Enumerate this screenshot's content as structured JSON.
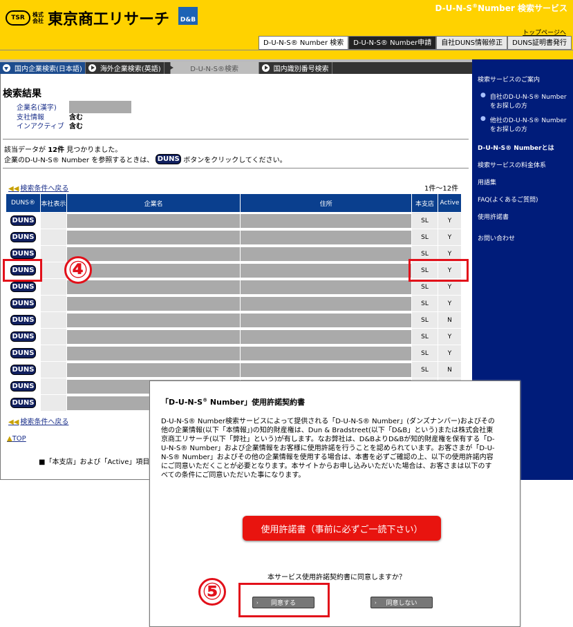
{
  "header": {
    "logo_mark": "TSR",
    "logo_kaisha": "株式会社",
    "logo_name": "東京商工リサーチ",
    "db_logo": "D&B",
    "service_title": "D-U-N-S",
    "service_title_sup": "®",
    "service_title_rest": "Number 検索サービス",
    "top_page_link": "トップページへ",
    "tabs": [
      {
        "label": "D-U-N-S® Number 検索",
        "state": "active"
      },
      {
        "label": "D-U-N-S® Number申請",
        "state": "dark"
      },
      {
        "label": "自社DUNS情報修正",
        "state": "normal"
      },
      {
        "label": "DUNS証明書発行",
        "state": "normal"
      }
    ]
  },
  "subnav": [
    {
      "label": "国内企業検索(日本語)",
      "state": "active"
    },
    {
      "label": "海外企業検索(英語)",
      "state": "normal"
    },
    {
      "label": "D-U-N-S®検索",
      "state": "dim"
    },
    {
      "label": "国内識別番号検索",
      "state": "normal"
    }
  ],
  "sidebar": {
    "title": "検索サービスのご案内",
    "sub_items": [
      "自社のD-U-N-S® Numberをお探しの方",
      "他社のD-U-N-S® Numberをお探しの方"
    ],
    "items": [
      "D-U-N-S® Numberとは",
      "検索サービスの料金体系",
      "用語集",
      "FAQ(よくあるご質問)",
      "使用許諾書",
      "お問い合わせ"
    ]
  },
  "results": {
    "title": "検索結果",
    "criteria": [
      {
        "label": "企業名(漢字)",
        "value": ""
      },
      {
        "label": "支社情報",
        "value": "含む"
      },
      {
        "label": "インアクティブ",
        "value": "含む"
      }
    ],
    "found_prefix": "該当データが",
    "found_count": "12件",
    "found_suffix": "見つかりました。",
    "hint_prefix": "企業のD-U-N-S® Number を参照するときは、",
    "hint_button": "DUNS",
    "hint_suffix": "ボタンをクリックしてください。",
    "back_link": "検索条件へ戻る",
    "range": "1件〜12件",
    "columns": [
      "DUNS®",
      "本社表示",
      "企業名",
      "住所",
      "本支店",
      "Active"
    ],
    "rows": [
      {
        "duns": "DUNS",
        "branch": "SL",
        "active": "Y"
      },
      {
        "duns": "DUNS",
        "branch": "SL",
        "active": "Y"
      },
      {
        "duns": "DUNS",
        "branch": "SL",
        "active": "Y"
      },
      {
        "duns": "DUNS",
        "branch": "SL",
        "active": "Y"
      },
      {
        "duns": "DUNS",
        "branch": "SL",
        "active": "Y"
      },
      {
        "duns": "DUNS",
        "branch": "SL",
        "active": "Y"
      },
      {
        "duns": "DUNS",
        "branch": "SL",
        "active": "N"
      },
      {
        "duns": "DUNS",
        "branch": "SL",
        "active": "Y"
      },
      {
        "duns": "DUNS",
        "branch": "SL",
        "active": "Y"
      },
      {
        "duns": "DUNS",
        "branch": "SL",
        "active": "N"
      },
      {
        "duns": "DUNS",
        "branch": "SL",
        "active": ""
      },
      {
        "duns": "DUNS",
        "branch": "",
        "active": ""
      }
    ],
    "top_link": "TOP",
    "note": "■「本支店」および「Active」項目の"
  },
  "callouts": {
    "step4": "④",
    "step5": "⑤"
  },
  "modal": {
    "title_pre": "「D-U-N-S",
    "title_sup": "®",
    "title_post": " Number」使用許諾契約書",
    "body": "D-U-N-S® Number検索サービスによって提供される「D-U-N-S® Number」(ダンズナンバー)およびその他の企業情報(以下「本情報」)の知的財産権は、Dun & Bradstreet(以下「D&B」という)または株式会社東京商工リサーチ(以下「弊社」という)が有します。なお弊社は、D&BよりD&Bが知的財産権を保有する「D-U-N-S® Number」および企業情報をお客様に使用許諾を行うことを認められています。お客さまが「D-U-N-S® Number」およびその他の企業情報を使用する場合は、本書を必ずご確認の上、以下の使用許諾内容にご同意いただくことが必要となります。本サイトからお申し込みいただいた場合は、お客さまは以下のすべての条件にご同意いただいた事になります。",
    "license_button": "使用許諾書（事前に必ずご一読下さい）",
    "question": "本サービス使用許諾契約書に同意しますか？",
    "agree": "同意する",
    "disagree": "同意しない"
  }
}
